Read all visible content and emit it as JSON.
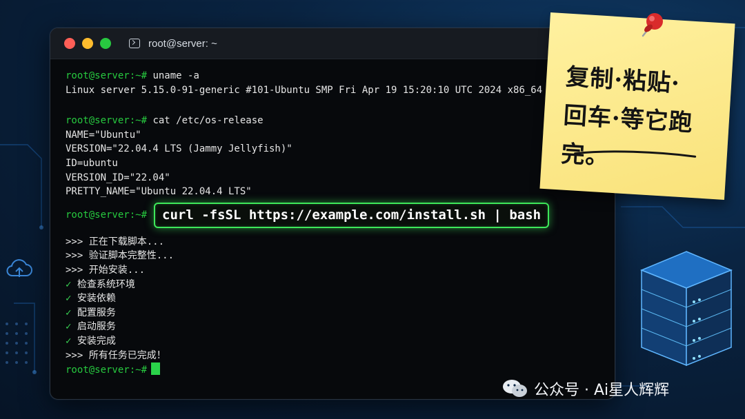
{
  "window": {
    "title": "root@server: ~"
  },
  "terminal": {
    "prompt": "root@server:~#",
    "block1": {
      "command": " uname -a",
      "output": [
        "Linux server 5.15.0-91-generic #101-Ubuntu SMP Fri Apr 19 15:20:10 UTC 2024 x86_64 GNU/Linux"
      ]
    },
    "block2": {
      "command": " cat /etc/os-release",
      "output": [
        "NAME=\"Ubuntu\"",
        "VERSION=\"22.04.4 LTS (Jammy Jellyfish)\"",
        "ID=ubuntu",
        "VERSION_ID=\"22.04\"",
        "PRETTY_NAME=\"Ubuntu 22.04.4 LTS\""
      ]
    },
    "highlighted_command": "curl -fsSL https://example.com/install.sh | bash",
    "progress": [
      ">>> 正在下载脚本...",
      ">>> 验证脚本完整性...",
      ">>> 开始安装..."
    ],
    "check_mark": "✓",
    "steps": [
      "检查系统环境",
      "安装依赖",
      "配置服务",
      "启动服务",
      "安装完成"
    ],
    "done": ">>> 所有任务已完成！"
  },
  "sticky_note": {
    "line1": "复制·粘贴·",
    "line2": "回车·等它跑完。"
  },
  "watermark": {
    "text": "公众号 · Ai星人辉辉"
  },
  "colors": {
    "prompt_green": "#27c93f",
    "highlight_border": "#3ee85a",
    "note_yellow": "#f9e27a"
  }
}
